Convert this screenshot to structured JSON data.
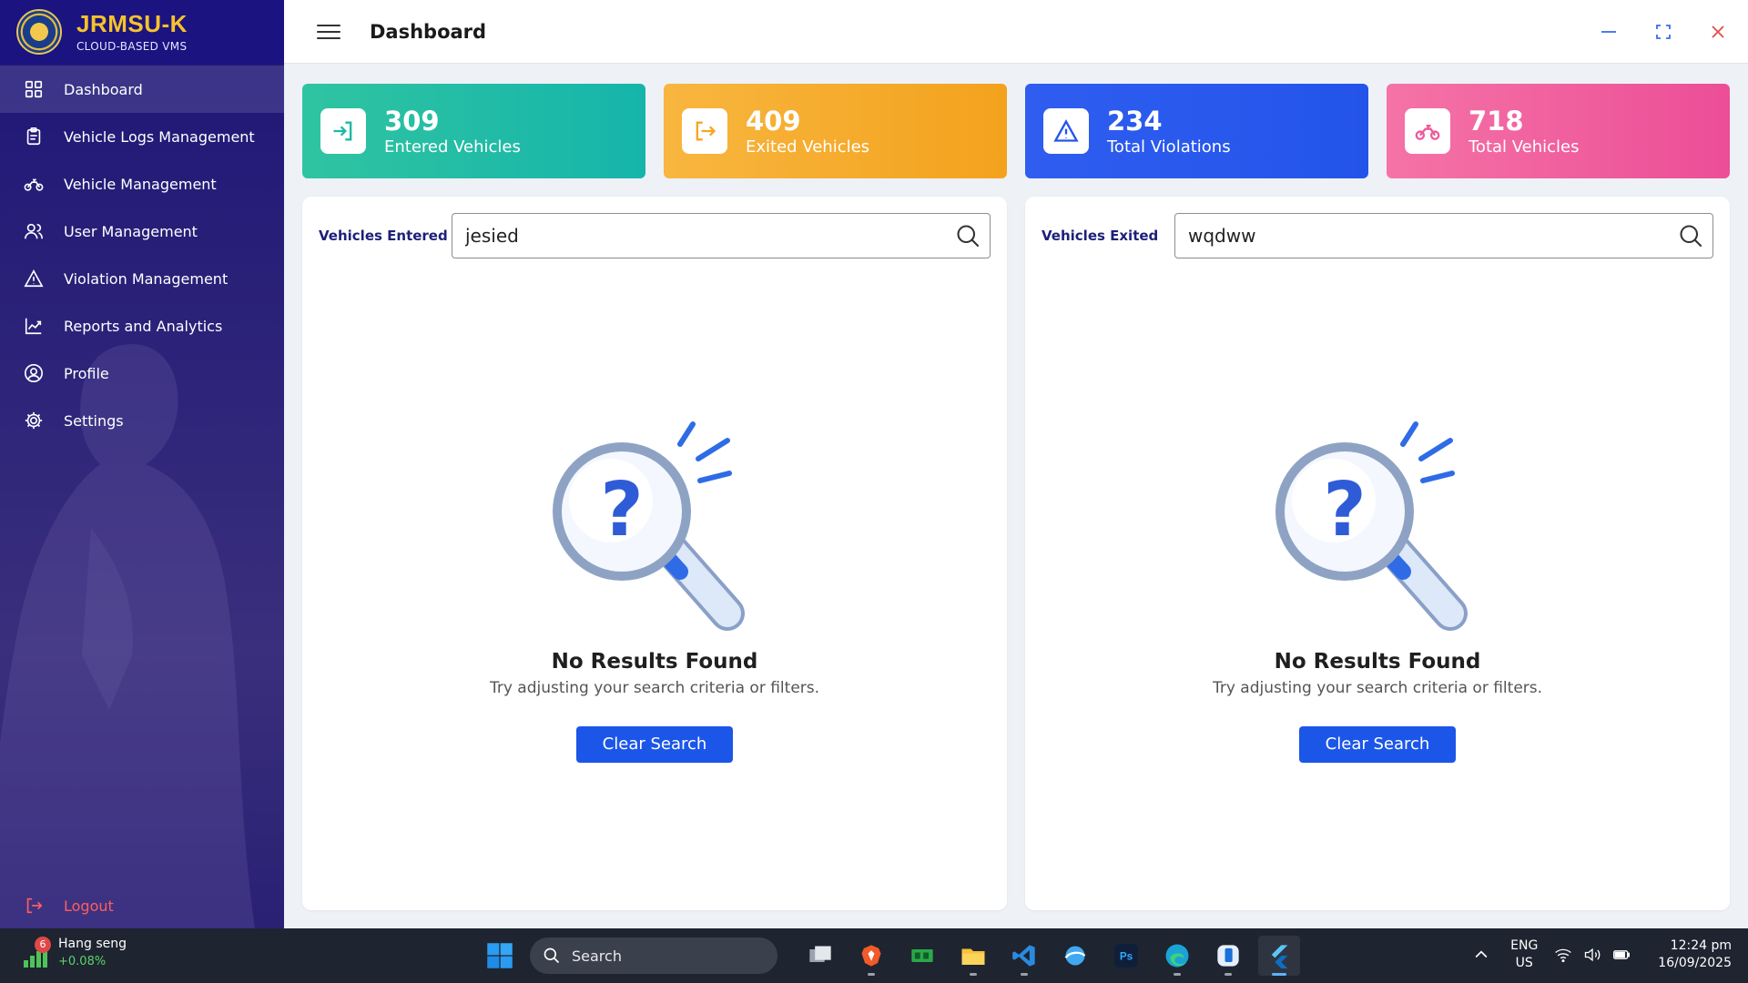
{
  "brand": {
    "name": "JRMSU-K",
    "subtitle": "CLOUD-BASED VMS"
  },
  "sidebar": {
    "items": [
      {
        "label": "Dashboard",
        "icon": "dashboard-grid-icon",
        "active": true
      },
      {
        "label": "Vehicle Logs Management",
        "icon": "clipboard-icon",
        "active": false
      },
      {
        "label": "Vehicle Management",
        "icon": "motorcycle-icon",
        "active": false
      },
      {
        "label": "User Management",
        "icon": "users-icon",
        "active": false
      },
      {
        "label": "Violation Management",
        "icon": "warning-triangle-icon",
        "active": false
      },
      {
        "label": "Reports and Analytics",
        "icon": "line-chart-icon",
        "active": false
      },
      {
        "label": "Profile",
        "icon": "user-circle-icon",
        "active": false
      },
      {
        "label": "Settings",
        "icon": "gear-icon",
        "active": false
      }
    ],
    "logout_label": "Logout"
  },
  "header": {
    "title": "Dashboard"
  },
  "stats": [
    {
      "value": "309",
      "label": "Entered Vehicles",
      "icon": "login-arrow-icon",
      "color": "#1cb8a8"
    },
    {
      "value": "409",
      "label": "Exited Vehicles",
      "icon": "logout-arrow-icon",
      "color": "#f5a623"
    },
    {
      "value": "234",
      "label": "Total Violations",
      "icon": "warning-triangle-icon",
      "color": "#2557eb"
    },
    {
      "value": "718",
      "label": "Total Vehicles",
      "icon": "motorcycle-icon",
      "color": "#ee5a9c"
    }
  ],
  "panels": {
    "entered": {
      "label": "Vehicles Entered",
      "search_value": "jesied",
      "empty_title": "No Results Found",
      "empty_text": "Try adjusting your search criteria or filters.",
      "clear_label": "Clear Search"
    },
    "exited": {
      "label": "Vehicles Exited",
      "search_value": "wqdww",
      "empty_title": "No Results Found",
      "empty_text": "Try adjusting your search criteria or filters.",
      "clear_label": "Clear Search"
    }
  },
  "taskbar": {
    "widget_badge": "6",
    "widget_name": "Hang seng",
    "widget_change": "+0.08%",
    "search_label": "Search",
    "lang_1": "ENG",
    "lang_2": "US",
    "time": "12:24 pm",
    "date": "16/09/2025"
  },
  "colors": {
    "accent": "#1c56e8",
    "sidebar": "#1e1677",
    "brand_gold": "#f6c22a",
    "logout": "#ff5e5e"
  }
}
